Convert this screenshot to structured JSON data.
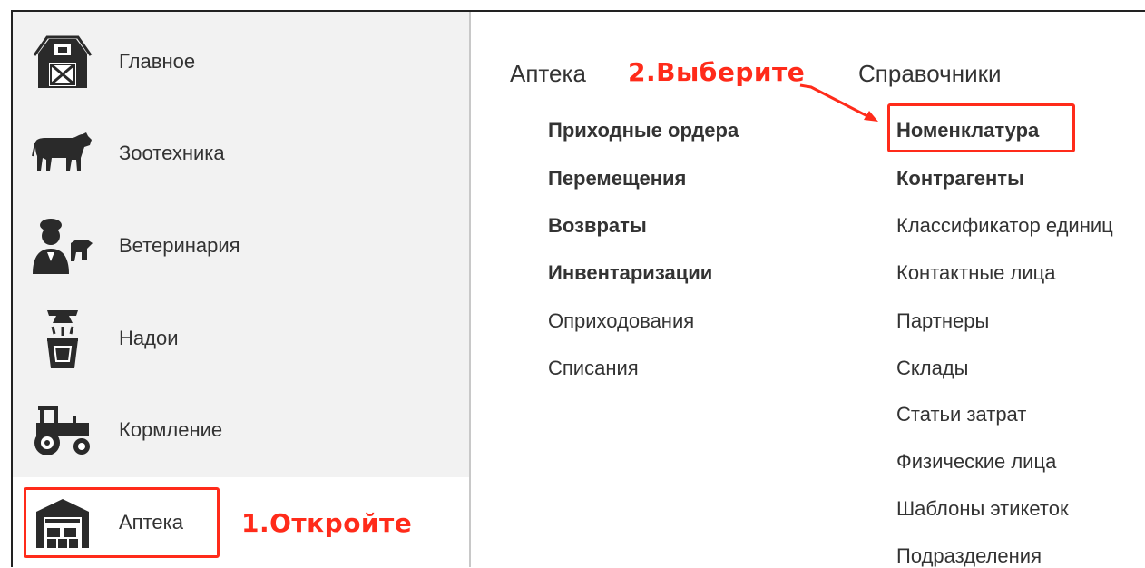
{
  "sidebar": {
    "items": [
      {
        "label": "Главное",
        "icon": "barn-icon"
      },
      {
        "label": "Зоотехника",
        "icon": "cow-icon"
      },
      {
        "label": "Ветеринария",
        "icon": "veterinarian-icon"
      },
      {
        "label": "Надои",
        "icon": "milk-icon"
      },
      {
        "label": "Кормление",
        "icon": "tractor-icon"
      },
      {
        "label": "Аптека",
        "icon": "warehouse-icon",
        "active": true
      }
    ]
  },
  "annotations": {
    "step1": "1.Откройте",
    "step2": "2.Выберите"
  },
  "content": {
    "section1": {
      "title": "Аптека",
      "links": [
        {
          "label": "Приходные ордера",
          "bold": true
        },
        {
          "label": "Перемещения",
          "bold": true
        },
        {
          "label": "Возвраты",
          "bold": true
        },
        {
          "label": "Инвентаризации",
          "bold": true
        },
        {
          "label": "Оприходования",
          "bold": false
        },
        {
          "label": "Списания",
          "bold": false
        }
      ]
    },
    "section2": {
      "title": "Справочники",
      "links": [
        {
          "label": "Номенклатура",
          "bold": true
        },
        {
          "label": "Контрагенты",
          "bold": true
        },
        {
          "label": "Классификатор единиц",
          "bold": false
        },
        {
          "label": "Контактные лица",
          "bold": false
        },
        {
          "label": "Партнеры",
          "bold": false
        },
        {
          "label": "Склады",
          "bold": false
        },
        {
          "label": "Статьи затрат",
          "bold": false
        },
        {
          "label": "Физические лица",
          "bold": false
        },
        {
          "label": "Шаблоны этикеток",
          "bold": false
        },
        {
          "label": "Подразделения",
          "bold": false
        }
      ]
    }
  },
  "colors": {
    "annotation": "#ff2b1a",
    "sidebar_bg": "#f2f2f2",
    "active_bg": "#ffffff"
  }
}
